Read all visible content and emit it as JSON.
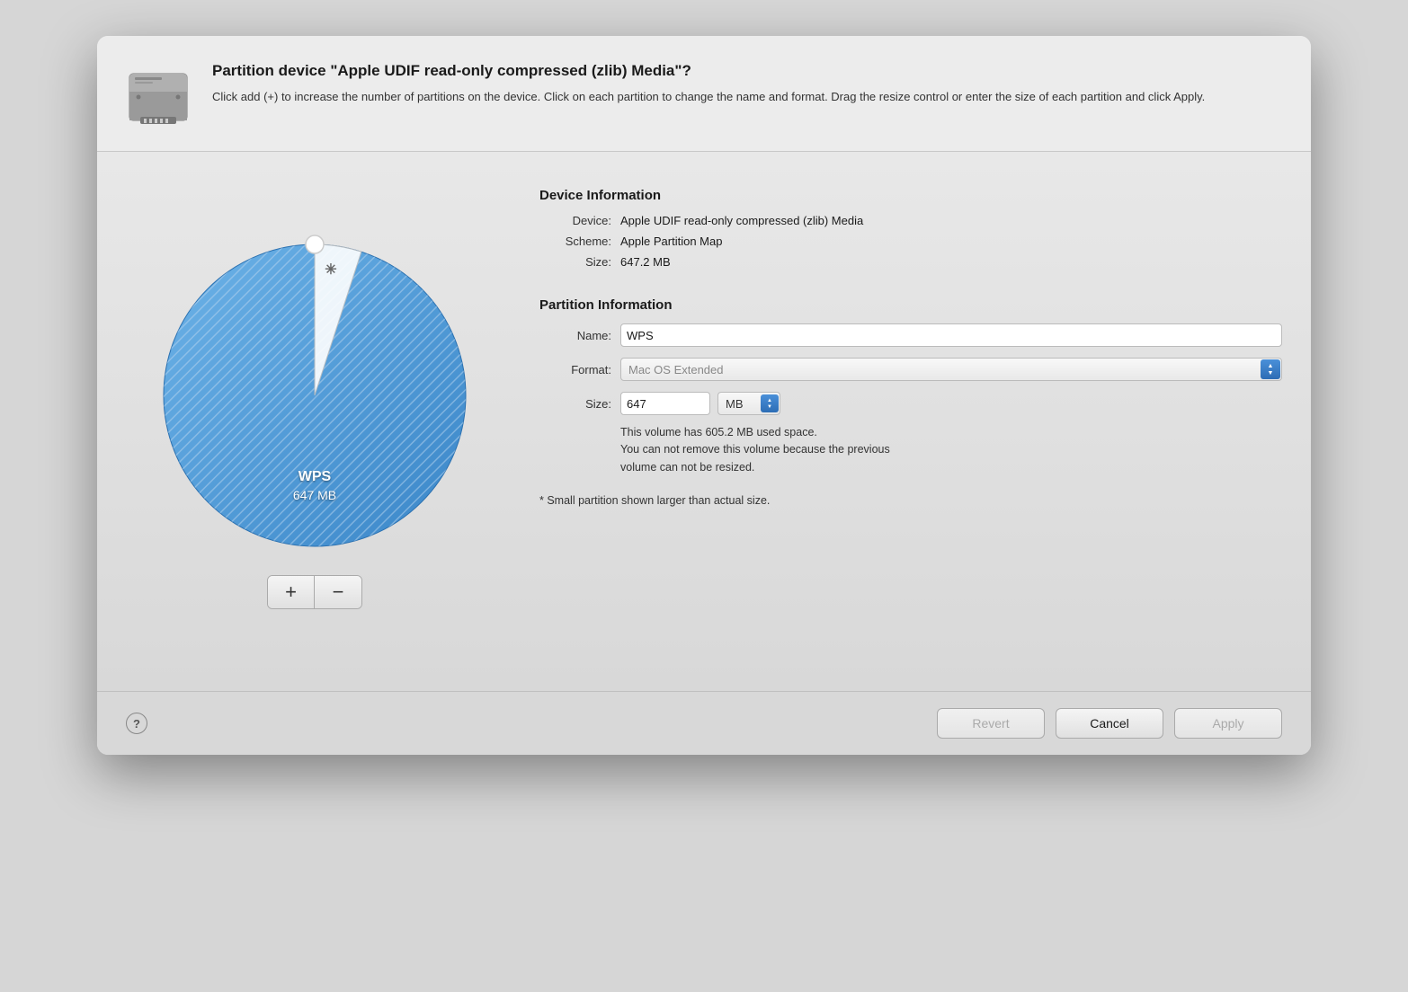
{
  "dialog": {
    "title": "Partition device \"Apple UDIF read-only compressed (zlib) Media\"?",
    "description": "Click add (+) to increase the number of partitions on the device. Click on each partition to change the name and format. Drag the resize control or enter the size of each partition and click Apply."
  },
  "device_info": {
    "section_title": "Device Information",
    "device_label": "Device:",
    "device_value": "Apple UDIF read-only compressed (zlib) Media",
    "scheme_label": "Scheme:",
    "scheme_value": "Apple Partition Map",
    "size_label": "Size:",
    "size_value": "647.2 MB"
  },
  "partition_info": {
    "section_title": "Partition Information",
    "name_label": "Name:",
    "name_value": "WPS",
    "format_label": "Format:",
    "format_placeholder": "Mac OS Extended",
    "size_label": "Size:",
    "size_value": "647",
    "size_unit": "MB",
    "notice_line1": "This volume has 605.2 MB used space.",
    "notice_line2": "You can not remove this volume because the previous",
    "notice_line3": "volume can not be resized.",
    "footnote": "* Small partition shown larger than actual size."
  },
  "chart": {
    "partition_name": "WPS",
    "partition_size": "647 MB"
  },
  "buttons": {
    "add_label": "+",
    "remove_label": "−",
    "help_label": "?",
    "revert_label": "Revert",
    "cancel_label": "Cancel",
    "apply_label": "Apply"
  },
  "icons": {
    "disk": "disk-icon"
  }
}
